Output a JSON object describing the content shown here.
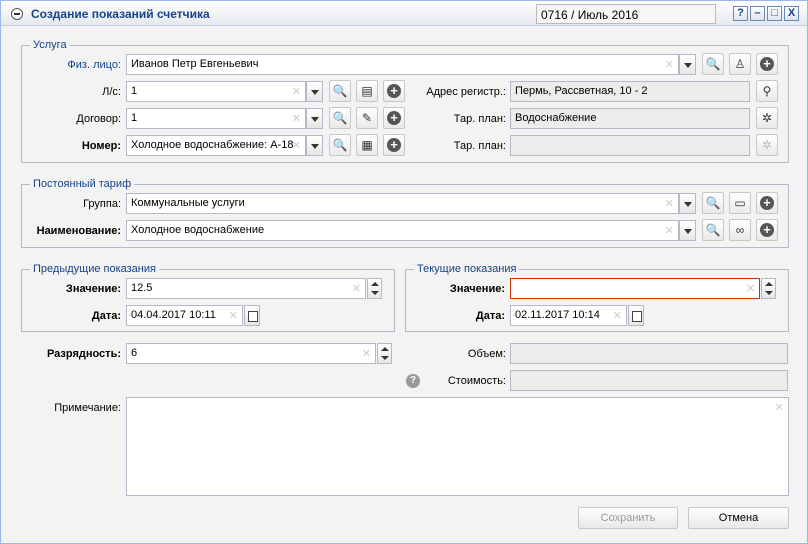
{
  "window": {
    "title": "Создание показаний счетчика",
    "period": "0716 / Июль 2016",
    "help_btn": "?",
    "min_btn": "–",
    "max_btn": "□",
    "close_btn": "X"
  },
  "service": {
    "legend": "Услуга",
    "person_label": "Физ. лицо:",
    "person_value": "Иванов Петр Евгеньевич",
    "account_label": "Л/с:",
    "account_value": "1",
    "contract_label": "Договор:",
    "contract_value": "1",
    "number_label": "Номер:",
    "number_value": "Холодное водоснабжение: А-18",
    "address_label": "Адрес регистр.:",
    "address_value": "Пермь, Рассветная, 10 - 2",
    "tariff1_label": "Тар. план:",
    "tariff1_value": "Водоснабжение",
    "tariff2_label": "Тар. план:",
    "tariff2_value": ""
  },
  "tariff": {
    "legend": "Постоянный тариф",
    "group_label": "Группа:",
    "group_value": "Коммунальные услуги",
    "name_label": "Наименование:",
    "name_value": "Холодное водоснабжение"
  },
  "prev": {
    "legend": "Предыдущие показания",
    "value_label": "Значение:",
    "value": "12.5",
    "date_label": "Дата:",
    "date": "04.04.2017 10:11"
  },
  "cur": {
    "legend": "Текущие показания",
    "value_label": "Значение:",
    "value": "",
    "date_label": "Дата:",
    "date": "02.11.2017 10:14"
  },
  "digits_label": "Разрядность:",
  "digits_value": "6",
  "volume_label": "Объем:",
  "volume_value": "",
  "cost_label": "Стоимость:",
  "cost_value": "",
  "note_label": "Примечание:",
  "note_value": "",
  "buttons": {
    "save": "Сохранить",
    "cancel": "Отмена"
  },
  "icons": {
    "collapse": "collapse-icon",
    "search": "search-icon",
    "person": "person-icon",
    "add": "plus-icon",
    "pin": "map-pin-icon",
    "calendar": "calendar-icon",
    "help": "help-icon"
  }
}
